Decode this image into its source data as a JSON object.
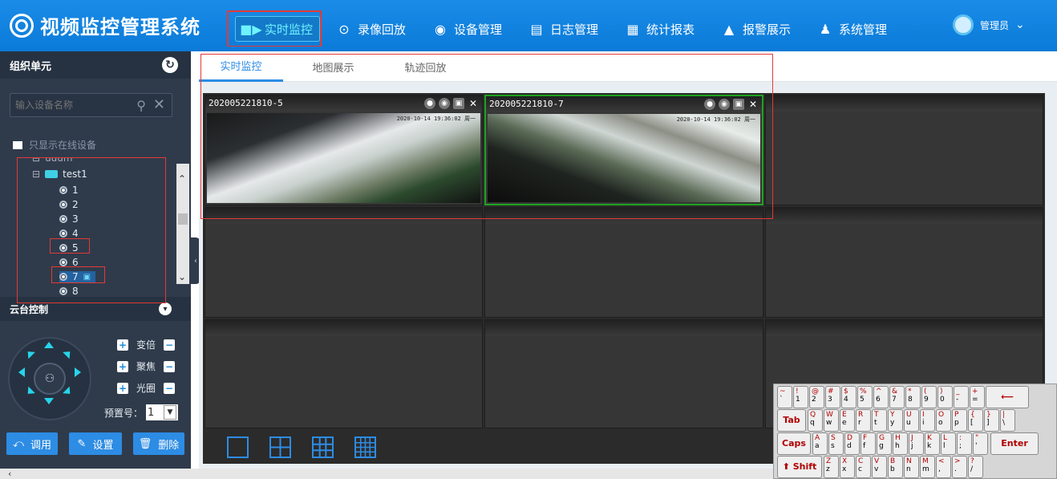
{
  "app": {
    "title": "视频监控管理系统"
  },
  "nav": [
    {
      "label": "实时监控",
      "icon": "video-camera-icon"
    },
    {
      "label": "录像回放",
      "icon": "play-circle-icon"
    },
    {
      "label": "设备管理",
      "icon": "dome-camera-icon"
    },
    {
      "label": "日志管理",
      "icon": "document-edit-icon"
    },
    {
      "label": "统计报表",
      "icon": "clipboard-icon"
    },
    {
      "label": "报警展示",
      "icon": "warning-icon"
    },
    {
      "label": "系统管理",
      "icon": "user-settings-icon"
    }
  ],
  "user": {
    "name": "管理员"
  },
  "sidebar": {
    "title": "组织单元",
    "search_placeholder": "输入设备名称",
    "online_only": "只显示在线设备",
    "tree": {
      "folder": "test1",
      "partial": "uuum",
      "channels": [
        "1",
        "2",
        "3",
        "4",
        "5",
        "6",
        "7",
        "8"
      ],
      "selected": "7"
    }
  },
  "ptz": {
    "title": "云台控制",
    "rows": [
      {
        "label": "变倍"
      },
      {
        "label": "聚焦"
      },
      {
        "label": "光圈"
      }
    ],
    "preset_label": "预置号：",
    "preset_value": "1",
    "buttons": {
      "call": "调用",
      "set": "设置",
      "delete": "删除"
    }
  },
  "tabs": [
    {
      "label": "实时监控",
      "active": true
    },
    {
      "label": "地图展示",
      "active": false
    },
    {
      "label": "轨迹回放",
      "active": false
    }
  ],
  "players": [
    {
      "title": "202005221810-5",
      "osd": "2020-10-14 19:36:02 周一"
    },
    {
      "title": "202005221810-7",
      "osd": "2020-10-14 19:36:02 周一"
    }
  ],
  "keyboard": {
    "row1": [
      [
        "~",
        "`"
      ],
      [
        "!",
        "1"
      ],
      [
        "@",
        "2"
      ],
      [
        "#",
        "3"
      ],
      [
        "$",
        "4"
      ],
      [
        "%",
        "5"
      ],
      [
        "^",
        "6"
      ],
      [
        "&",
        "7"
      ],
      [
        "*",
        "8"
      ],
      [
        "(",
        "9"
      ],
      [
        ")",
        "0"
      ],
      [
        "_",
        "-"
      ],
      [
        "+",
        "="
      ]
    ],
    "row2": [
      [
        "Q",
        "q"
      ],
      [
        "W",
        "w"
      ],
      [
        "E",
        "e"
      ],
      [
        "R",
        "r"
      ],
      [
        "T",
        "t"
      ],
      [
        "Y",
        "y"
      ],
      [
        "U",
        "u"
      ],
      [
        "I",
        "i"
      ],
      [
        "O",
        "o"
      ],
      [
        "P",
        "p"
      ],
      [
        "{",
        "["
      ],
      [
        "}",
        "]"
      ],
      [
        "|",
        "\\"
      ]
    ],
    "row3": [
      [
        "A",
        "a"
      ],
      [
        "S",
        "s"
      ],
      [
        "D",
        "d"
      ],
      [
        "F",
        "f"
      ],
      [
        "G",
        "g"
      ],
      [
        "H",
        "h"
      ],
      [
        "J",
        "j"
      ],
      [
        "K",
        "k"
      ],
      [
        "L",
        "l"
      ],
      [
        ":",
        ";"
      ],
      [
        "\"",
        "'"
      ]
    ],
    "row4": [
      [
        "Z",
        "z"
      ],
      [
        "X",
        "x"
      ],
      [
        "C",
        "c"
      ],
      [
        "V",
        "v"
      ],
      [
        "B",
        "b"
      ],
      [
        "N",
        "n"
      ],
      [
        "M",
        "m"
      ],
      [
        "<",
        ","
      ],
      [
        ">",
        "."
      ],
      [
        "?",
        "/"
      ]
    ],
    "tab": "Tab",
    "caps": "Caps",
    "shift": "⬆ Shift",
    "enter": "Enter",
    "backspace": "⟵"
  },
  "colors": {
    "primary": "#2d8ce4",
    "header": "#1a8ce8",
    "sidebar": "#2f3b4b",
    "selected_border": "#1ea31e",
    "annotation": "#e53935"
  }
}
